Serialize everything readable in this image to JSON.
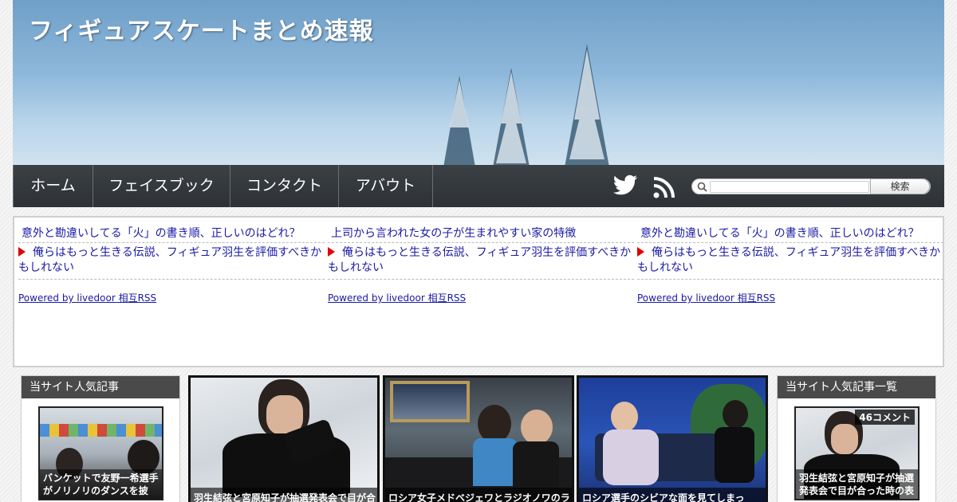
{
  "site": {
    "title": "フィギュアスケートまとめ速報"
  },
  "nav": {
    "items": [
      "ホーム",
      "フェイスブック",
      "コンタクト",
      "アバウト"
    ],
    "icons": [
      "twitter-icon",
      "rss-icon"
    ],
    "search_button": "検索",
    "search_placeholder": ""
  },
  "rss": {
    "columns": [
      {
        "link1": "意外と勘違いしてる「火」の書き順、正しいのはどれ？",
        "link2": "俺らはもっと生きる伝説、フィギュア羽生を評価すべきかもしれない",
        "powered": "Powered by livedoor 相互RSS"
      },
      {
        "link1": "上司から言われた女の子が生まれやすい家の特徴",
        "link2": "俺らはもっと生きる伝説、フィギュア羽生を評価すべきかもしれない",
        "powered": "Powered by livedoor 相互RSS"
      },
      {
        "link1": "意外と勘違いしてる「火」の書き順、正しいのはどれ？",
        "link2": "俺らはもっと生きる伝説、フィギュア羽生を評価すべきかもしれない",
        "powered": "Powered by livedoor 相互RSS"
      }
    ]
  },
  "widgets": {
    "left_title": "当サイト人気記事",
    "left_caption": "バンケットで友野一希選手がノリノリのダンスを披",
    "right_title": "当サイト人気記事一覧",
    "right_caption": "羽生結弦と宮原知子が抽選発表会で目が合った時の表",
    "right_badge": "46コメント"
  },
  "features": [
    {
      "caption": "羽生結弦と宮原知子が抽選発表会で目が合"
    },
    {
      "caption": "ロシア女子メドベジェワとラジオノワのラ"
    },
    {
      "caption": "ロシア選手のシビアな面を見てしまっ"
    }
  ],
  "colors": {
    "nav_bg": "#33383c",
    "link": "#1a1aa6",
    "bullet": "#e00000",
    "widget_title_bg": "#4a4a4a"
  }
}
